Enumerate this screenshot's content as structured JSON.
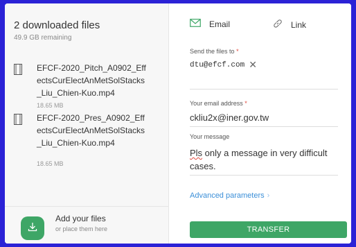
{
  "files_panel": {
    "title": "2 downloaded files",
    "remaining": "49.9 GB remaining",
    "files": [
      {
        "name": "EFCF-2020_Pitch_A0902_EffectsCurElectAnMetSolStacks_Liu_Chien-Kuo.mp4",
        "size": "18.65 MB",
        "icon": "file-icon"
      },
      {
        "name": "EFCF-2020_Pres_A0902_EffectsCurElectAnMetSolStacks_Liu_Chien-Kuo.mp4",
        "size": "18.65 MB",
        "icon": "file-icon"
      }
    ],
    "add": {
      "title": "Add your files",
      "subtitle": "or place them here",
      "icon": "download-icon"
    }
  },
  "tabs": [
    {
      "label": "Email",
      "icon": "mail-icon",
      "active": true
    },
    {
      "label": "Link",
      "icon": "link-icon",
      "active": false
    }
  ],
  "form": {
    "send_to_label": "Send the files to",
    "send_to_required": "*",
    "recipient": "dtu@efcf.com",
    "remove_symbol": "✕",
    "your_email_label": "Your email address",
    "your_email_required": "*",
    "your_email_value": "ckliu2x@iner.gov.tw",
    "message_label": "Your message",
    "message_first_word": "Pls",
    "message_rest": " only a message in very difficult cases.",
    "advanced_label": "Advanced parameters",
    "advanced_chevron": "›",
    "transfer_label": "TRANSFER"
  },
  "colors": {
    "accent_green": "#3ea666",
    "link_blue": "#3b8fd8",
    "required_red": "#e04a3f",
    "background_blue": "#2b22d6"
  }
}
